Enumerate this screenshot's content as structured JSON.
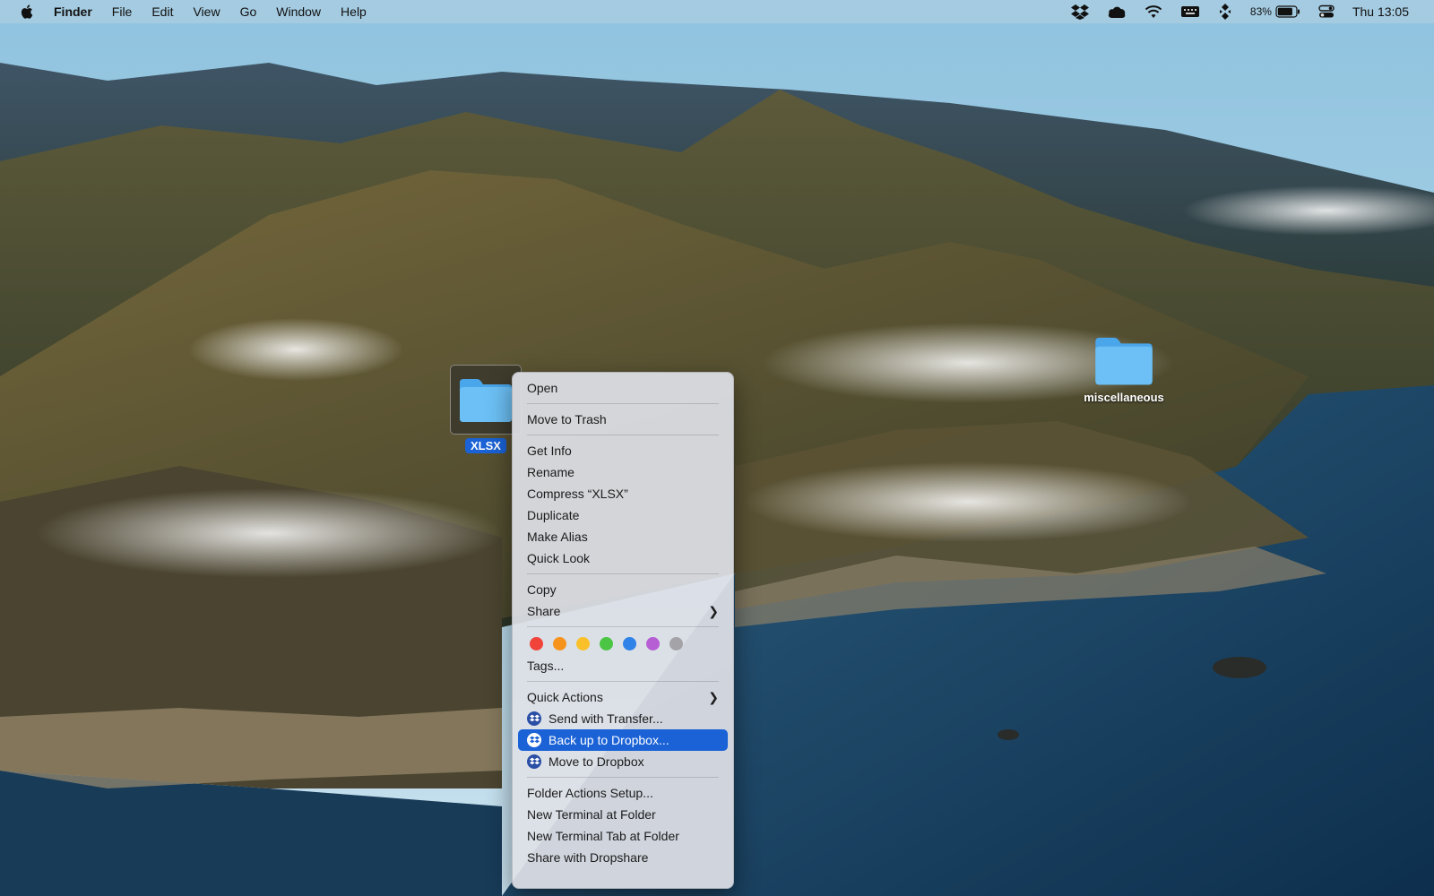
{
  "menubar": {
    "app_name": "Finder",
    "menus": [
      "File",
      "Edit",
      "View",
      "Go",
      "Window",
      "Help"
    ],
    "battery_percent": "83%",
    "battery_level": 0.83,
    "clock": "Thu 13:05"
  },
  "desktop": {
    "selected_folder": {
      "label": "XLSX"
    },
    "other_folder": {
      "label": "miscellaneous"
    }
  },
  "context_menu": {
    "open": "Open",
    "move_to_trash": "Move to Trash",
    "get_info": "Get Info",
    "rename": "Rename",
    "compress": "Compress “XLSX”",
    "duplicate": "Duplicate",
    "make_alias": "Make Alias",
    "quick_look": "Quick Look",
    "copy": "Copy",
    "share": "Share",
    "tag_colors": [
      "#f0433a",
      "#f6931d",
      "#f9c02a",
      "#4cc544",
      "#2f82e8",
      "#b65ed4",
      "#a3a3a8"
    ],
    "tags": "Tags...",
    "quick_actions": "Quick Actions",
    "send_with_transfer": "Send with Transfer...",
    "back_up_to_dropbox": "Back up to Dropbox...",
    "move_to_dropbox": "Move to Dropbox",
    "folder_actions_setup": "Folder Actions Setup...",
    "new_terminal_at_folder": "New Terminal at Folder",
    "new_terminal_tab_at_folder": "New Terminal Tab at Folder",
    "share_with_dropshare": "Share with Dropshare",
    "highlight_color": "#1a62d6"
  }
}
